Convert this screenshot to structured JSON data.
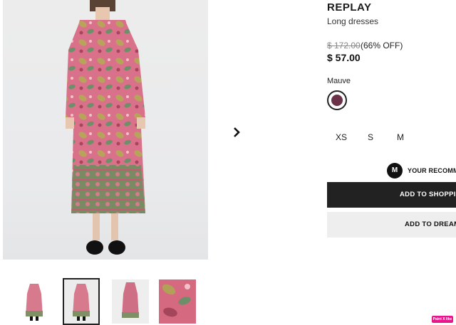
{
  "product": {
    "brand": "REPLAY",
    "category": "Long dresses",
    "original_price": "$ 172.00",
    "discount": "(66% OFF)",
    "price": "$ 57.00",
    "color_label": "Mauve",
    "color_swatch": "#6b3148",
    "sizes": [
      "XS",
      "S",
      "M"
    ]
  },
  "gallery": {
    "next_icon": "chevron-right-icon",
    "thumbnails": [
      "front view",
      "front view",
      "back view",
      "fabric detail"
    ],
    "selected_index": 1
  },
  "recommend": {
    "badge": "M",
    "text": "YOUR RECOMM"
  },
  "actions": {
    "add_to_bag": "ADD TO SHOPPIN",
    "add_to_dream": "ADD TO DREAM"
  },
  "extension_badge": "Paint X like"
}
